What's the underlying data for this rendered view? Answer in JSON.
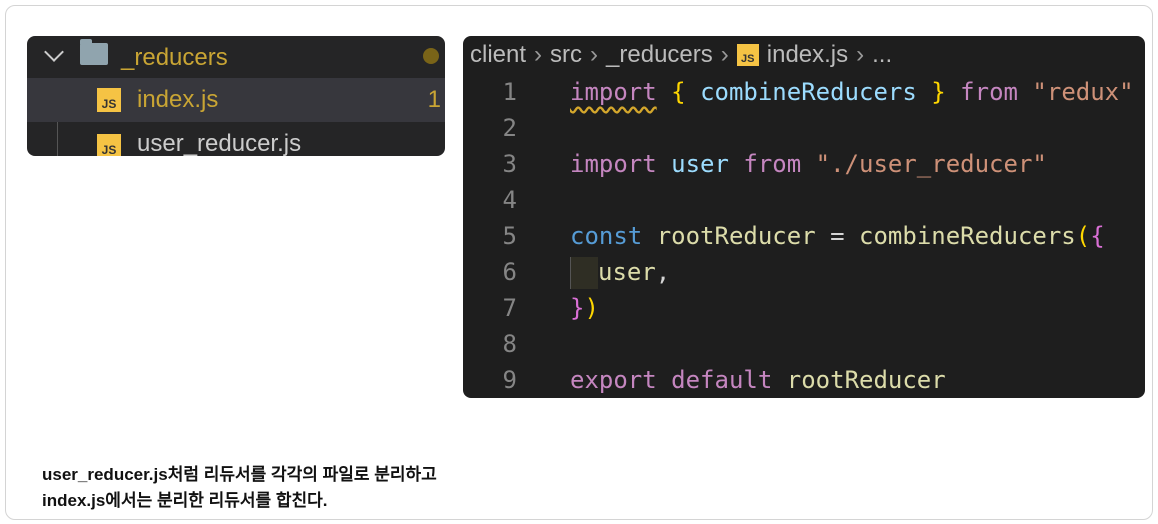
{
  "explorer": {
    "folder": "_reducers",
    "files": [
      {
        "name": "index.js",
        "badge": "1",
        "icon": "js-file-icon"
      },
      {
        "name": "user_reducer.js",
        "icon": "js-file-icon"
      }
    ],
    "js_icon_label": "JS"
  },
  "breadcrumb": [
    "client",
    "src",
    "_reducers",
    "index.js",
    "..."
  ],
  "code": {
    "line_numbers": [
      "1",
      "2",
      "3",
      "4",
      "5",
      "6",
      "7",
      "8",
      "9"
    ],
    "l1": [
      "import",
      "{",
      "combineReducers",
      "}",
      "from",
      "\"redux\""
    ],
    "l3": [
      "import",
      "user",
      "from",
      "\"./user_reducer\""
    ],
    "l5": [
      "const",
      "rootReducer",
      "=",
      "combineReducers",
      "(",
      "{"
    ],
    "l6": [
      "user",
      ","
    ],
    "l7": [
      "}",
      ")"
    ],
    "l9": [
      "export",
      "default",
      "rootReducer"
    ]
  },
  "caption": [
    "user_reducer.js처럼 리듀서를 각각의 파일로 분리하고",
    "index.js에서는 분리한 리듀서를 합친다."
  ],
  "colors": {
    "keyword": "#c586c0",
    "string": "#ce9178",
    "variable": "#9cdcfe",
    "function": "#dcdcaa"
  }
}
